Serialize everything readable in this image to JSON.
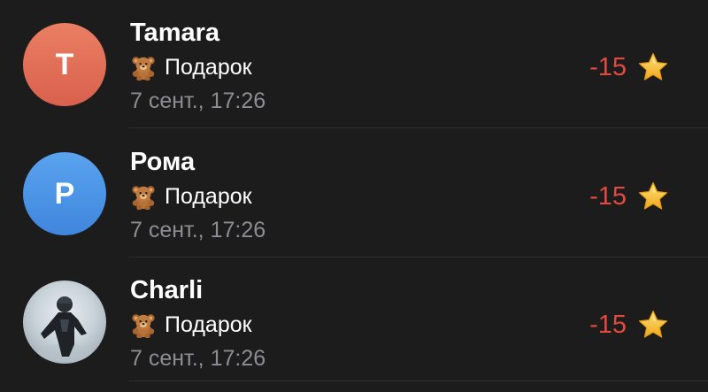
{
  "colors": {
    "background": "#1c1c1d",
    "amount_negative": "#e5483d",
    "secondary_text": "#8d8d92",
    "avatar_tamara": "#e3705a",
    "avatar_roma": "#4d95e6"
  },
  "transactions": [
    {
      "avatar_letter": "T",
      "avatar_type": "initial",
      "name": "Tamara",
      "gift_icon": "teddy-bear-icon",
      "gift_label": "Подарок",
      "date": "7 сент., 17:26",
      "amount": "-15",
      "currency_icon": "star-icon"
    },
    {
      "avatar_letter": "Р",
      "avatar_type": "initial",
      "name": "Рома",
      "gift_icon": "teddy-bear-icon",
      "gift_label": "Подарок",
      "date": "7 сент., 17:26",
      "amount": "-15",
      "currency_icon": "star-icon"
    },
    {
      "avatar_letter": "",
      "avatar_type": "photo",
      "name": "Charli",
      "gift_icon": "teddy-bear-icon",
      "gift_label": "Подарок",
      "date": "7 сент., 17:26",
      "amount": "-15",
      "currency_icon": "star-icon"
    }
  ]
}
